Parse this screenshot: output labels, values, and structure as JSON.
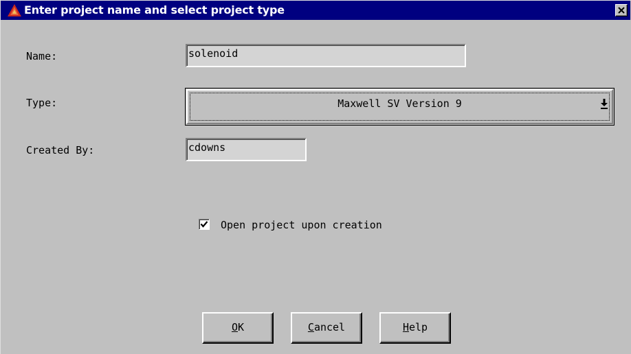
{
  "dialog": {
    "title": "Enter project name and select project type",
    "close_icon": "close-icon",
    "app_icon": "maxwell-logo-icon"
  },
  "form": {
    "name_label": "Name:",
    "name_value": "solenoid",
    "type_label": "Type:",
    "type_value": "Maxwell SV Version 9",
    "created_by_label": "Created By:",
    "created_by_value": "cdowns"
  },
  "options": {
    "open_on_create_label": "Open project upon creation",
    "open_on_create_checked": true
  },
  "buttons": {
    "ok": {
      "mnemonic": "O",
      "rest": "K"
    },
    "cancel": {
      "mnemonic": "C",
      "rest": "ancel"
    },
    "help": {
      "mnemonic": "H",
      "rest": "elp"
    }
  },
  "colors": {
    "titlebar": "#000080",
    "dialog_bg": "#c0c0c0",
    "icon_red": "#c8281e"
  }
}
